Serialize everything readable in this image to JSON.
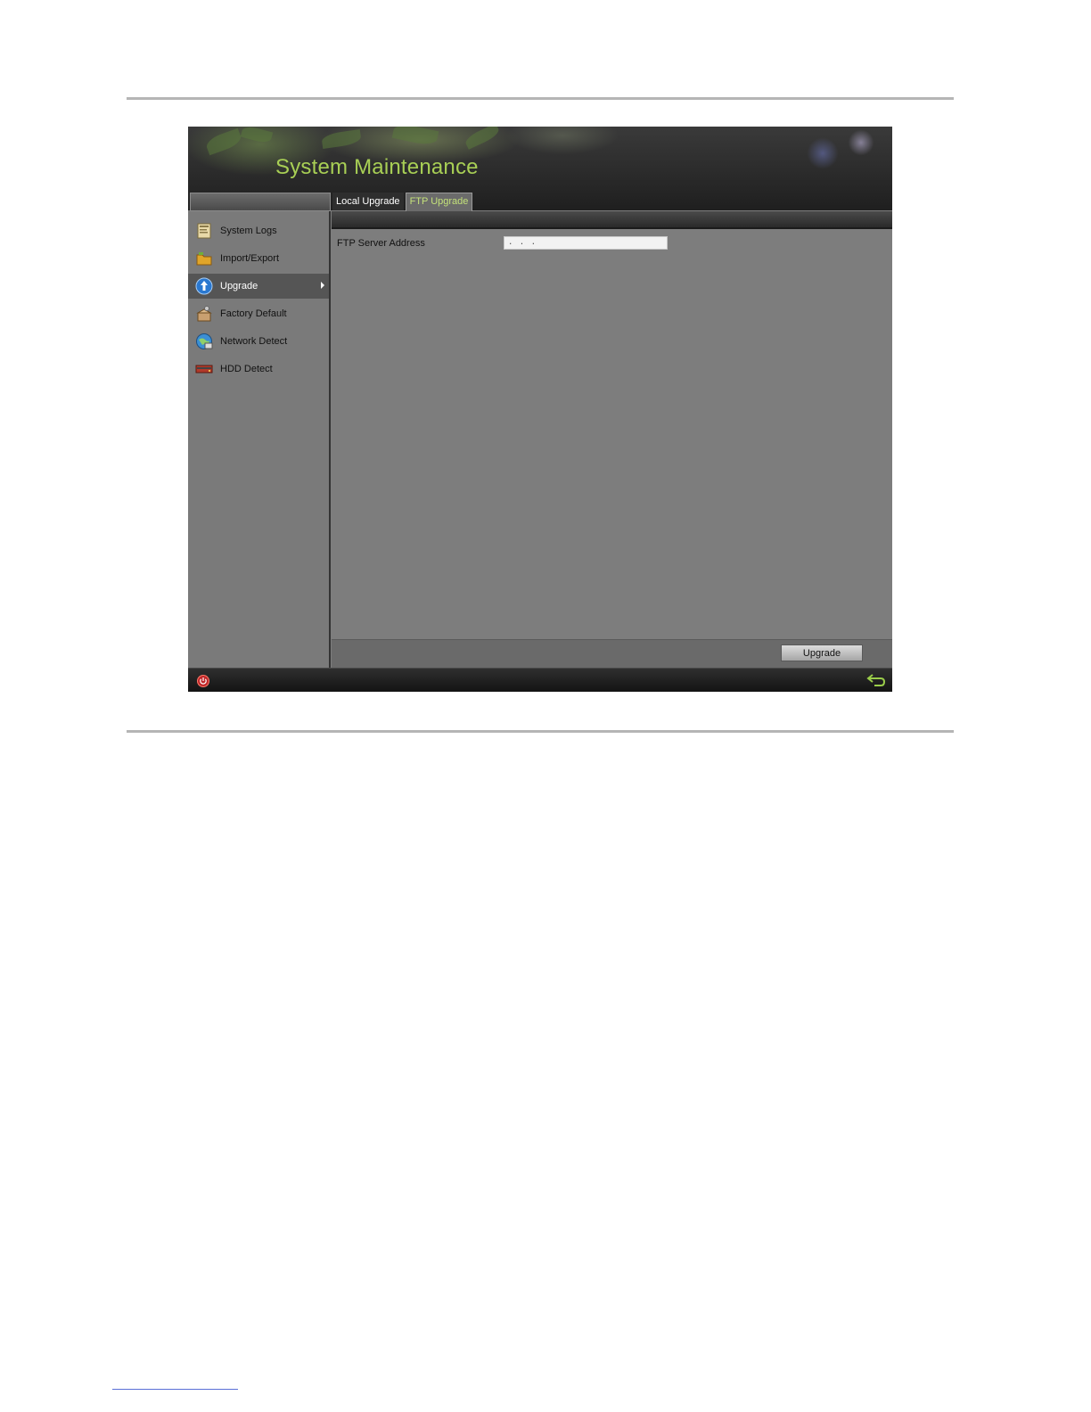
{
  "window": {
    "title": "System Maintenance",
    "tabs": [
      {
        "label": "Local Upgrade",
        "active": false
      },
      {
        "label": "FTP Upgrade",
        "active": true
      }
    ],
    "sidebar": {
      "items": [
        {
          "label": "System Logs",
          "icon": "log-book-icon"
        },
        {
          "label": "Import/Export",
          "icon": "folder-icon"
        },
        {
          "label": "Upgrade",
          "icon": "upgrade-icon",
          "active": true
        },
        {
          "label": "Factory Default",
          "icon": "factory-default-icon"
        },
        {
          "label": "Network Detect",
          "icon": "network-globe-icon"
        },
        {
          "label": "HDD Detect",
          "icon": "hdd-icon"
        }
      ]
    },
    "form": {
      "ftp_label": "FTP Server Address",
      "ftp_value": ".   .   ."
    },
    "buttons": {
      "upgrade_label": "Upgrade"
    }
  },
  "colors": {
    "title_green": "#a8cf55",
    "active_tab_text": "#c3e07a",
    "panel_gray": "#7d7d7d"
  }
}
